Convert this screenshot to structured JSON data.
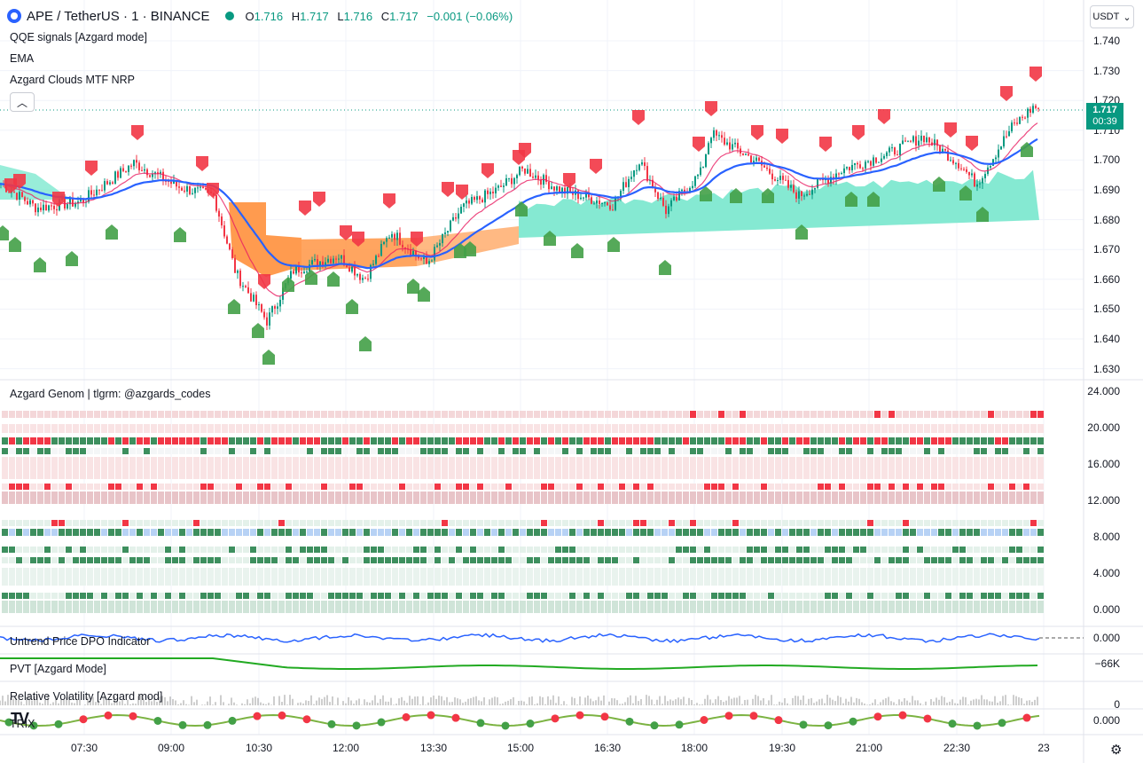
{
  "header": {
    "symbol": "APE / TetherUS · 1 · BINANCE",
    "o_label": "O",
    "o": "1.716",
    "h_label": "H",
    "h": "1.717",
    "l_label": "L",
    "l": "1.716",
    "c_label": "C",
    "c": "1.717",
    "change": "−0.001 (−0.06%)"
  },
  "currency_button": "USDT",
  "indicators": {
    "qqe": "QQE signals [Azgard mode]",
    "ema": "EMA",
    "clouds": "Azgard Clouds MTF NRP",
    "genom": "Azgard Genom | tlgrm: @azgards_codes",
    "dpo": "Untrend Price DPO Indicator",
    "pvt": "PVT [Azgard Mode]",
    "relvol": "Relative Volatility [Azgard mod]",
    "trix": "TRIX"
  },
  "price_axis": [
    "1.740",
    "1.730",
    "1.720",
    "1.710",
    "1.700",
    "1.690",
    "1.680",
    "1.670",
    "1.660",
    "1.650",
    "1.640",
    "1.630"
  ],
  "genom_axis": [
    "24.000",
    "20.000",
    "16.000",
    "12.000",
    "8.000",
    "4.000",
    "0.000"
  ],
  "dpo_axis": "0.000",
  "pvt_axis": "−66K",
  "relvol_axis": "0",
  "trix_axis": "0.000",
  "last_price": "1.717",
  "countdown": "00:39",
  "time_axis": [
    "07:30",
    "09:00",
    "10:30",
    "12:00",
    "13:30",
    "15:00",
    "16:30",
    "18:00",
    "19:30",
    "21:00",
    "22:30",
    "23"
  ],
  "colors": {
    "up": "#089981",
    "down": "#f23645",
    "ema": "#2962ff",
    "cloud_green": "#7ee8d0",
    "cloud_orange": "#ff9b4f"
  }
}
